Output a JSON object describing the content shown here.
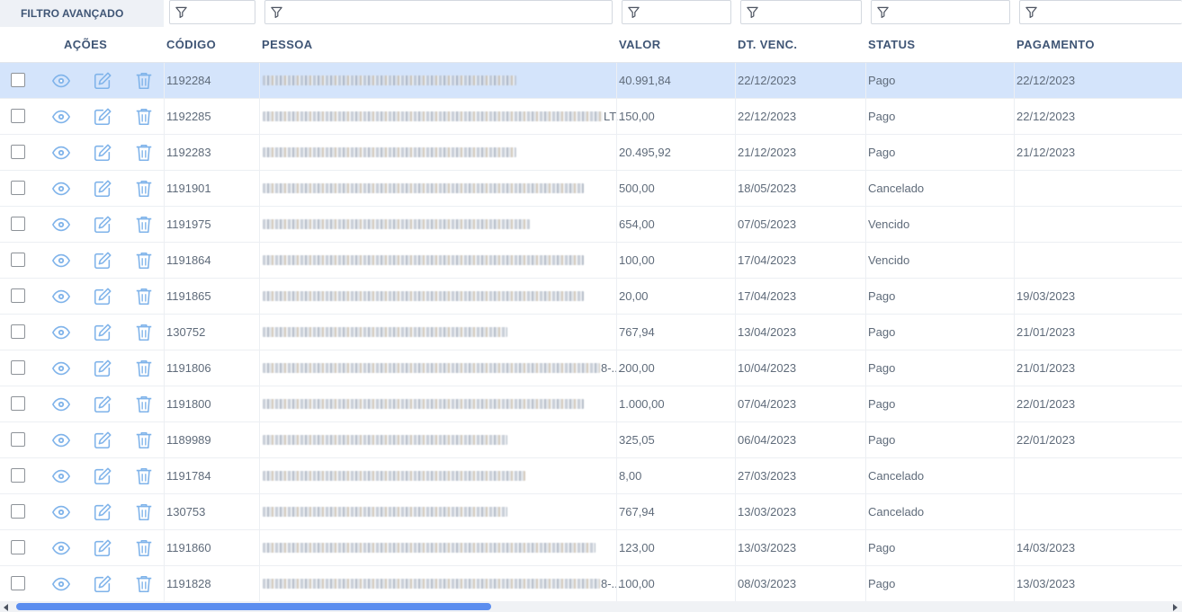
{
  "filter": {
    "label": "FILTRO AVANÇADO"
  },
  "columns": {
    "acoes": "AÇÕES",
    "codigo": "CÓDIGO",
    "pessoa": "PESSOA",
    "valor": "VALOR",
    "dt_venc": "DT. VENC.",
    "status": "STATUS",
    "pagamento": "PAGAMENTO"
  },
  "icons": {
    "filter": "filter-icon",
    "view": "eye-icon",
    "edit": "edit-icon",
    "delete": "trash-icon",
    "color": "#7fb3ea"
  },
  "rows": [
    {
      "codigo": "1192284",
      "pessoa_suffix": "",
      "valor": "40.991,84",
      "dt_venc": "22/12/2023",
      "status": "Pago",
      "pagamento": "22/12/2023",
      "selected": true
    },
    {
      "codigo": "1192285",
      "pessoa_suffix": "LT...",
      "valor": "150,00",
      "dt_venc": "22/12/2023",
      "status": "Pago",
      "pagamento": "22/12/2023",
      "selected": false
    },
    {
      "codigo": "1192283",
      "pessoa_suffix": "",
      "valor": "20.495,92",
      "dt_venc": "21/12/2023",
      "status": "Pago",
      "pagamento": "21/12/2023",
      "selected": false
    },
    {
      "codigo": "1191901",
      "pessoa_suffix": "",
      "valor": "500,00",
      "dt_venc": "18/05/2023",
      "status": "Cancelado",
      "pagamento": "",
      "selected": false
    },
    {
      "codigo": "1191975",
      "pessoa_suffix": "",
      "valor": "654,00",
      "dt_venc": "07/05/2023",
      "status": "Vencido",
      "pagamento": "",
      "selected": false
    },
    {
      "codigo": "1191864",
      "pessoa_suffix": "",
      "valor": "100,00",
      "dt_venc": "17/04/2023",
      "status": "Vencido",
      "pagamento": "",
      "selected": false
    },
    {
      "codigo": "1191865",
      "pessoa_suffix": "",
      "valor": "20,00",
      "dt_venc": "17/04/2023",
      "status": "Pago",
      "pagamento": "19/03/2023",
      "selected": false
    },
    {
      "codigo": "130752",
      "pessoa_suffix": "",
      "valor": "767,94",
      "dt_venc": "13/04/2023",
      "status": "Pago",
      "pagamento": "21/01/2023",
      "selected": false
    },
    {
      "codigo": "1191806",
      "pessoa_suffix": "8-...",
      "valor": "200,00",
      "dt_venc": "10/04/2023",
      "status": "Pago",
      "pagamento": "21/01/2023",
      "selected": false
    },
    {
      "codigo": "1191800",
      "pessoa_suffix": "",
      "valor": "1.000,00",
      "dt_venc": "07/04/2023",
      "status": "Pago",
      "pagamento": "22/01/2023",
      "selected": false
    },
    {
      "codigo": "1189989",
      "pessoa_suffix": "",
      "valor": "325,05",
      "dt_venc": "06/04/2023",
      "status": "Pago",
      "pagamento": "22/01/2023",
      "selected": false
    },
    {
      "codigo": "1191784",
      "pessoa_suffix": "",
      "valor": "8,00",
      "dt_venc": "27/03/2023",
      "status": "Cancelado",
      "pagamento": "",
      "selected": false
    },
    {
      "codigo": "130753",
      "pessoa_suffix": "",
      "valor": "767,94",
      "dt_venc": "13/03/2023",
      "status": "Cancelado",
      "pagamento": "",
      "selected": false
    },
    {
      "codigo": "1191860",
      "pessoa_suffix": "",
      "valor": "123,00",
      "dt_venc": "13/03/2023",
      "status": "Pago",
      "pagamento": "14/03/2023",
      "selected": false
    },
    {
      "codigo": "1191828",
      "pessoa_suffix": "8-...",
      "valor": "100,00",
      "dt_venc": "08/03/2023",
      "status": "Pago",
      "pagamento": "13/03/2023",
      "selected": false
    }
  ],
  "scrollbar": {
    "horizontal_position": 0.0
  }
}
